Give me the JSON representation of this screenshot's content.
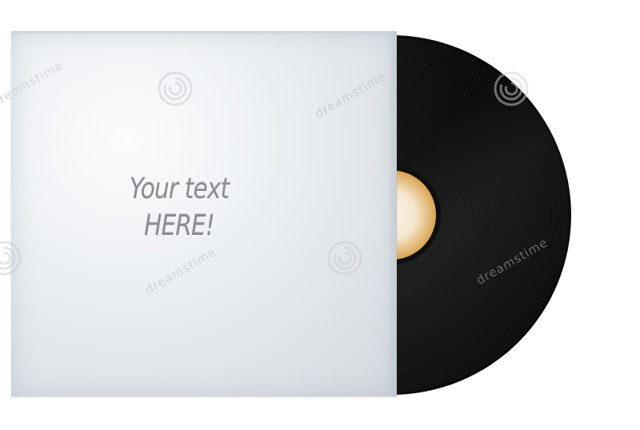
{
  "sleeve": {
    "line1": "Your text",
    "line2": "HERE!"
  },
  "watermark": {
    "brand": "dreamstime",
    "icon": "dreamstime-swirl-logo"
  },
  "colors": {
    "sleeve": "#e6eaee",
    "record": "#0b0b0b",
    "label_center": "#f7efe0",
    "label_edge": "#d9a450",
    "text": "#8a8d90"
  }
}
